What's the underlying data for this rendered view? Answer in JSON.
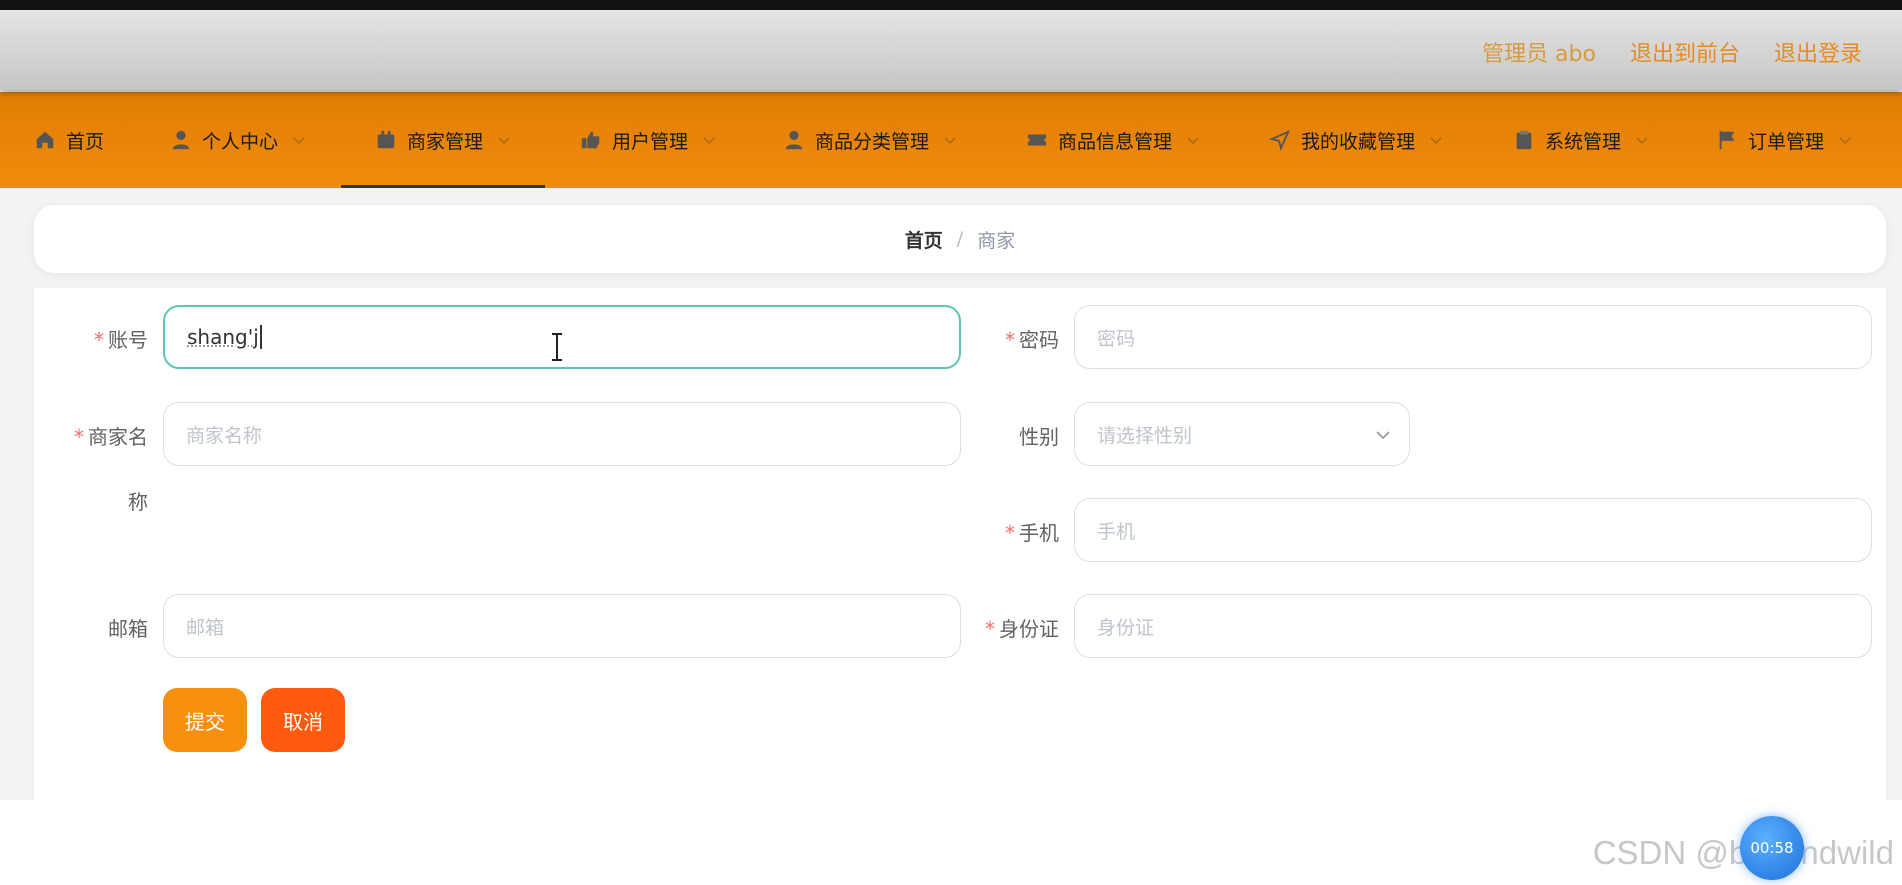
{
  "header": {
    "admin_label": "管理员 abo",
    "to_front_label": "退出到前台",
    "logout_label": "退出登录"
  },
  "nav": {
    "items": [
      {
        "label": "首页",
        "icon": "home-icon"
      },
      {
        "label": "个人中心",
        "icon": "user-icon"
      },
      {
        "label": "商家管理",
        "icon": "store-icon"
      },
      {
        "label": "用户管理",
        "icon": "thumb-icon"
      },
      {
        "label": "商品分类管理",
        "icon": "user-icon"
      },
      {
        "label": "商品信息管理",
        "icon": "ticket-icon"
      },
      {
        "label": "我的收藏管理",
        "icon": "send-icon"
      },
      {
        "label": "系统管理",
        "icon": "clipboard-icon"
      },
      {
        "label": "订单管理",
        "icon": "flag-icon"
      }
    ],
    "active_index": 2
  },
  "breadcrumb": {
    "home": "首页",
    "separator": "/",
    "current": "商家"
  },
  "form": {
    "account_label": "账号",
    "account_value": "shang'j",
    "password_label": "密码",
    "password_placeholder": "密码",
    "merchant_name_label_1": "商家名",
    "merchant_name_label_2": "称",
    "merchant_name_placeholder": "商家名称",
    "gender_label": "性别",
    "gender_placeholder": "请选择性别",
    "phone_label": "手机",
    "phone_placeholder": "手机",
    "email_label": "邮箱",
    "email_placeholder": "邮箱",
    "id_card_label": "身份证",
    "id_card_placeholder": "身份证",
    "required_mark": "*"
  },
  "buttons": {
    "submit": "提交",
    "cancel": "取消"
  },
  "overlay": {
    "watermark": "CSDN @beyondwild",
    "timer": "00:58"
  },
  "colors": {
    "nav_bg": "#f08c0c",
    "header_link": "#e98a1e",
    "focus_border": "#5cc7b6",
    "submit": "#f7900f",
    "cancel": "#ff5a0e",
    "required": "#f56c6c"
  }
}
